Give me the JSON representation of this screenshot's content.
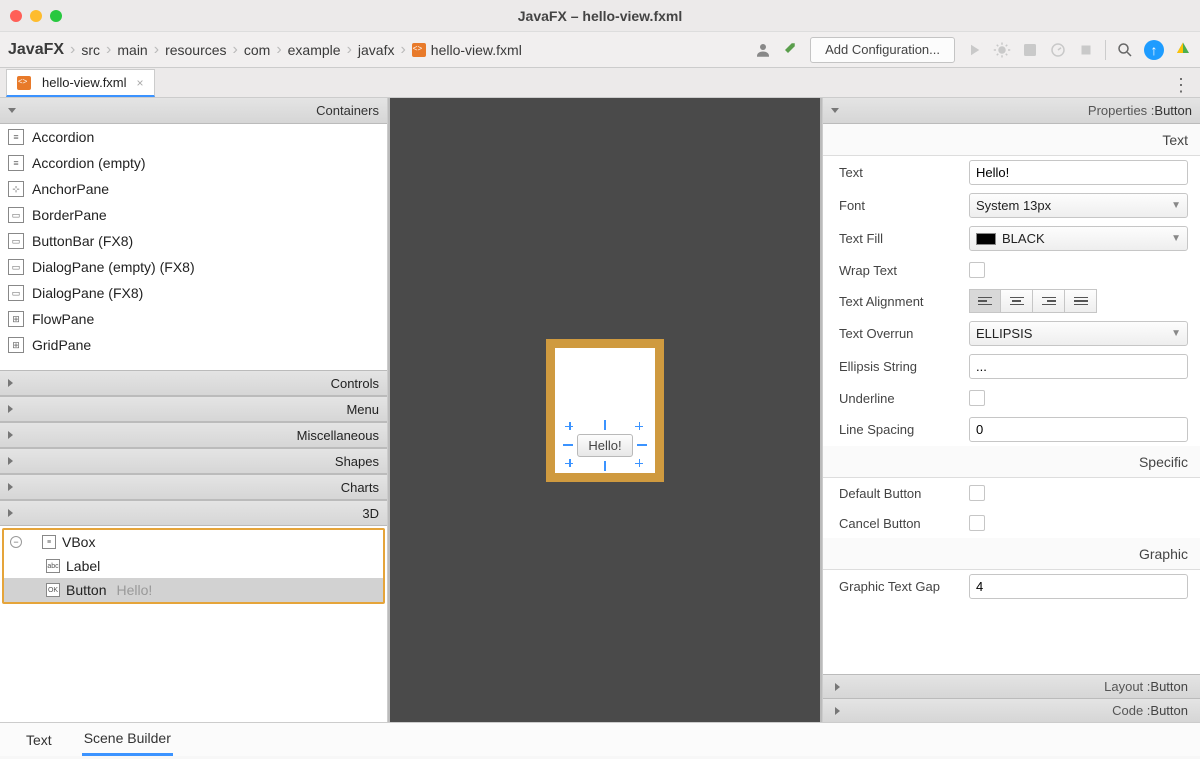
{
  "window": {
    "title_app": "JavaFX",
    "title_sep": " – ",
    "title_file": "hello-view.fxml"
  },
  "breadcrumbs": [
    "JavaFX",
    "src",
    "main",
    "resources",
    "com",
    "example",
    "javafx",
    "hello-view.fxml"
  ],
  "toolbar": {
    "config_btn": "Add Configuration..."
  },
  "file_tab": {
    "name": "hello-view.fxml"
  },
  "left": {
    "header_containers": "Containers",
    "containers": [
      "Accordion",
      "Accordion  (empty)",
      "AnchorPane",
      "BorderPane",
      "ButtonBar  (FX8)",
      "DialogPane (empty)  (FX8)",
      "DialogPane  (FX8)",
      "FlowPane",
      "GridPane"
    ],
    "categories": [
      "Controls",
      "Menu",
      "Miscellaneous",
      "Shapes",
      "Charts",
      "3D"
    ],
    "hierarchy": {
      "root": "VBox",
      "child1": "Label",
      "child2_name": "Button",
      "child2_text": "Hello!"
    }
  },
  "canvas": {
    "button_text": "Hello!"
  },
  "props": {
    "title_prefix": "Properties : ",
    "title_suffix": "Button",
    "sec_text": "Text",
    "sec_specific": "Specific",
    "sec_graphic": "Graphic",
    "rows": {
      "text_lbl": "Text",
      "text_val": "Hello!",
      "font_lbl": "Font",
      "font_val": "System 13px",
      "fill_lbl": "Text Fill",
      "fill_val": "BLACK",
      "wrap_lbl": "Wrap Text",
      "align_lbl": "Text Alignment",
      "overrun_lbl": "Text Overrun",
      "overrun_val": "ELLIPSIS",
      "ellipsis_lbl": "Ellipsis String",
      "ellipsis_val": "...",
      "underline_lbl": "Underline",
      "linesp_lbl": "Line Spacing",
      "linesp_val": "0",
      "defbtn_lbl": "Default Button",
      "cancel_lbl": "Cancel Button",
      "gtg_lbl": "Graphic Text Gap",
      "gtg_val": "4"
    },
    "collapsed": {
      "layout_pre": "Layout : ",
      "layout_suf": "Button",
      "code_pre": "Code : ",
      "code_suf": "Button"
    }
  },
  "bottom_tabs": {
    "text": "Text",
    "scene": "Scene Builder"
  }
}
